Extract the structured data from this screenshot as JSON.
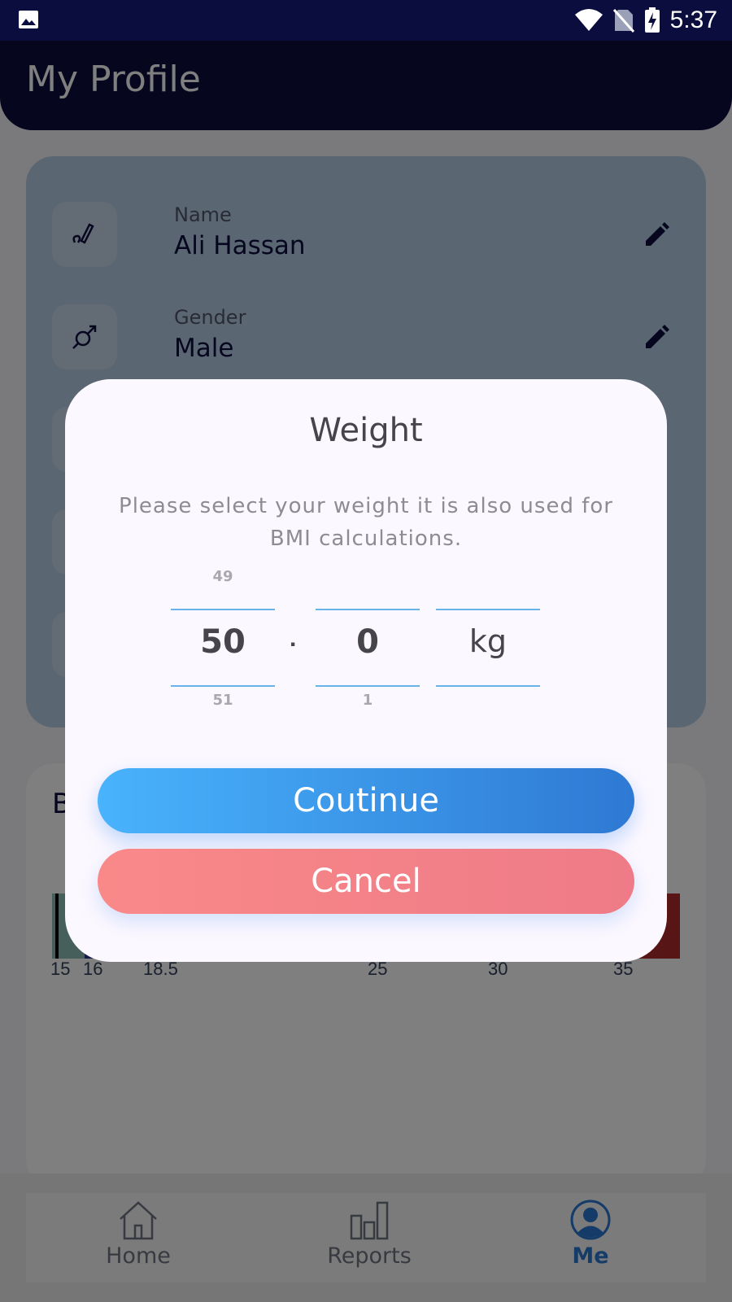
{
  "status_bar": {
    "time": "5:37"
  },
  "header": {
    "title": "My Profile"
  },
  "profile": {
    "rows": [
      {
        "label": "Name",
        "value": "Ali Hassan",
        "icon": "signature-icon"
      },
      {
        "label": "Gender",
        "value": "Male",
        "icon": "gender-icon"
      }
    ]
  },
  "bmi": {
    "title": "B",
    "ticks": [
      "15",
      "16",
      "18.5",
      "25",
      "30",
      "35"
    ],
    "colors": [
      "#8cbfb4",
      "#2b3a8f",
      "#b02a2a"
    ]
  },
  "dialog": {
    "title": "Weight",
    "description": "Please select your weight it is also used for BMI calculations.",
    "picker": {
      "integer": {
        "prev": "49",
        "current": "50",
        "next": "51"
      },
      "separator": ".",
      "decimal": {
        "prev": "",
        "current": "0",
        "next": "1"
      },
      "unit": "kg"
    },
    "continue_label": "Coutinue",
    "cancel_label": "Cancel"
  },
  "nav": {
    "items": [
      {
        "label": "Home",
        "icon": "home-icon"
      },
      {
        "label": "Reports",
        "icon": "bar-chart-icon"
      },
      {
        "label": "Me",
        "icon": "user-avatar-icon",
        "active": true
      }
    ]
  }
}
